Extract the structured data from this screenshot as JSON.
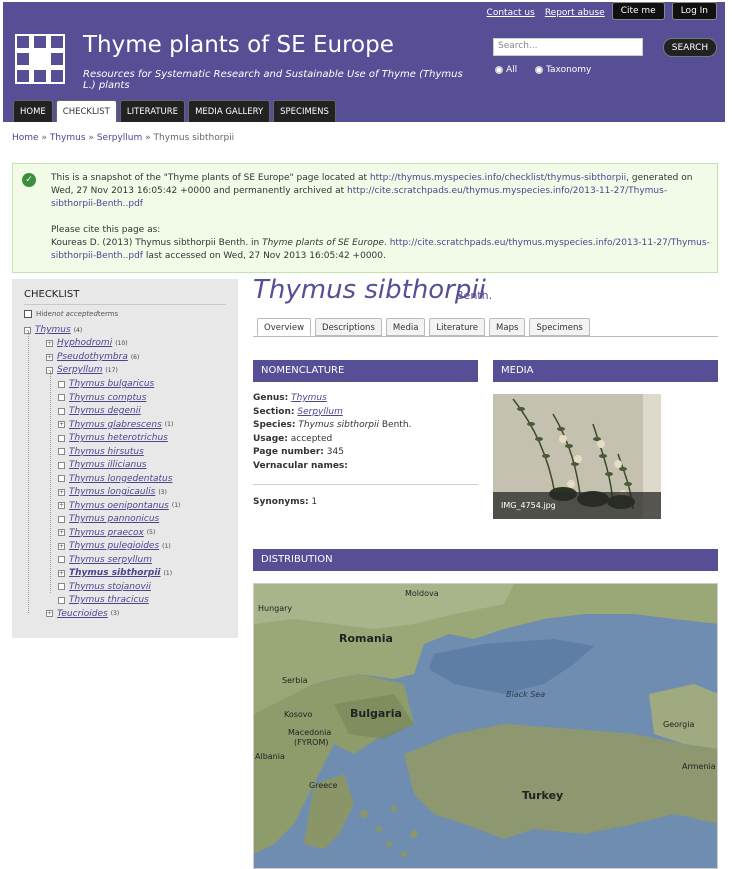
{
  "header": {
    "site_title": "Thyme plants of SE Europe",
    "site_slogan": "Resources for Systematic Research and Sustainable Use of Thyme (Thymus L.) plants",
    "contact_link": "Contact us",
    "report_link": "Report abuse",
    "cite_button": "Cite me",
    "login_button": "Log In",
    "search_placeholder": "Search...",
    "search_button": "SEARCH",
    "radio_all": "All",
    "radio_taxonomy": "Taxonomy",
    "tabs": [
      "HOME",
      "CHECKLIST",
      "LITERATURE",
      "MEDIA GALLERY",
      "SPECIMENS"
    ],
    "active_tab": "CHECKLIST",
    "brand_color": "#574f96"
  },
  "breadcrumb": {
    "items": [
      "Home",
      "Thymus",
      "Serpyllum"
    ],
    "current": "Thymus sibthorpii",
    "separator": "»"
  },
  "snapshot": {
    "line1_pre": "This is a snapshot of the \"Thyme plants of SE Europe\" page located at ",
    "line1_link": "http://thymus.myspecies.info/checklist/thymus-sibthorpii",
    "line1_mid": ", generated on Wed, 27 Nov 2013 16:05:42 +0000 and permanently archived at ",
    "line1_link2": "http://cite.scratchpads.eu/thymus.myspecies.info/2013-11-27/Thymus-sibthorpii-Benth..pdf",
    "cite_intro": "Please cite this page as:",
    "cite_pre": "Koureas D. (2013) Thymus sibthorpii Benth. in ",
    "cite_site": "Thyme plants of SE Europe",
    "cite_link": "http://cite.scratchpads.eu/thymus.myspecies.info/2013-11-27/Thymus-sibthorpii-Benth..pdf",
    "cite_post": " last accessed on Wed, 27 Nov 2013 16:05:42 +0000."
  },
  "checklist": {
    "heading": "CHECKLIST",
    "hide_label_pre": "Hide ",
    "hide_label_em": "not accepted",
    "hide_label_post": " terms",
    "tree": [
      {
        "name": "Thymus",
        "count": "(4)"
      },
      {
        "name": "Hyphodromi",
        "count": "(10)"
      },
      {
        "name": "Pseudothymbra",
        "count": "(6)"
      },
      {
        "name": "Serpyllum",
        "count": "(17)"
      },
      {
        "name": "Thymus bulgaricus",
        "count": ""
      },
      {
        "name": "Thymus comptus",
        "count": ""
      },
      {
        "name": "Thymus degenii",
        "count": ""
      },
      {
        "name": "Thymus glabrescens",
        "count": "(1)"
      },
      {
        "name": "Thymus heterotrichus",
        "count": ""
      },
      {
        "name": "Thymus hirsutus",
        "count": ""
      },
      {
        "name": "Thymus illicianus",
        "count": ""
      },
      {
        "name": "Thymus longedentatus",
        "count": ""
      },
      {
        "name": "Thymus longicaulis",
        "count": "(3)"
      },
      {
        "name": "Thymus oenipontanus",
        "count": "(1)"
      },
      {
        "name": "Thymus pannonicus",
        "count": ""
      },
      {
        "name": "Thymus praecox",
        "count": "(5)"
      },
      {
        "name": "Thymus pulegioides",
        "count": "(1)"
      },
      {
        "name": "Thymus serpyllum",
        "count": ""
      },
      {
        "name": "Thymus sibthorpii",
        "count": "(1)"
      },
      {
        "name": "Thymus stojanovii",
        "count": ""
      },
      {
        "name": "Thymus thracicus",
        "count": ""
      },
      {
        "name": "Teucrioides",
        "count": "(3)"
      }
    ]
  },
  "taxon": {
    "name": "Thymus sibthorpii",
    "author": "Benth.",
    "subtabs": [
      "Overview",
      "Descriptions",
      "Media",
      "Literature",
      "Maps",
      "Specimens"
    ],
    "active_subtab": "Overview"
  },
  "nomenclature": {
    "heading": "NOMENCLATURE",
    "genus_label": "Genus:",
    "genus": "Thymus",
    "section_label": "Section:",
    "section": "Serpyllum",
    "species_label": "Species:",
    "species": "Thymus sibthorpii",
    "species_author": "Benth.",
    "usage_label": "Usage:",
    "usage": "accepted",
    "page_label": "Page number:",
    "page": "345",
    "vernacular_label": "Vernacular names:",
    "synonyms_label": "Synonyms:",
    "synonyms": "1"
  },
  "media": {
    "heading": "MEDIA",
    "caption": "IMG_4754.jpg"
  },
  "distribution": {
    "heading": "DISTRIBUTION",
    "labels": [
      "Hungary",
      "Moldova",
      "Romania",
      "Serbia",
      "Bulgaria",
      "Black Sea",
      "Kosovo",
      "Macedonia",
      "(FYROM)",
      "Georgia",
      "Albania",
      "Armenia",
      "Greece",
      "Turkey"
    ]
  }
}
